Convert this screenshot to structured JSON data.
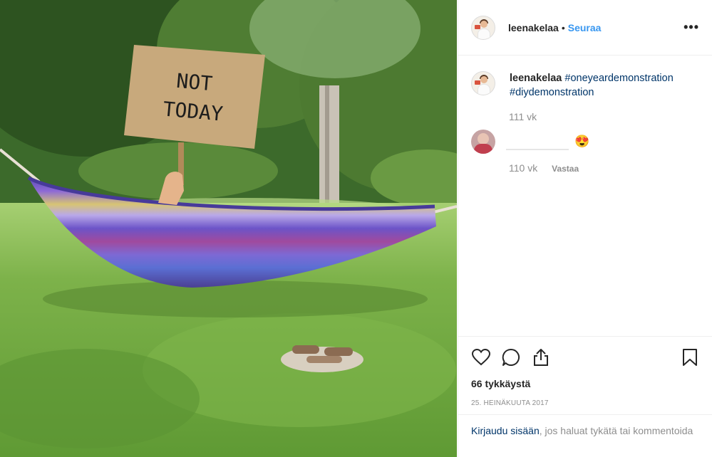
{
  "photo": {
    "sign_line1": "NOT",
    "sign_line2": "TODAY",
    "colors": {
      "grass": "#6fa842",
      "foliage": "#2f5a22",
      "sign": "#c8a97c"
    }
  },
  "header": {
    "username": "leenakelaa",
    "separator": "•",
    "follow_label": "Seuraa",
    "more_label": "•••"
  },
  "caption": {
    "username": "leenakelaa",
    "tag1": "#oneyeardemonstration",
    "tag2": "#diydemonstration",
    "time": "111 vk"
  },
  "comment": {
    "emoji": "😍",
    "time": "110 vk",
    "reply_label": "Vastaa"
  },
  "actions": {
    "icons": [
      "heart-icon",
      "comment-icon",
      "share-icon",
      "bookmark-icon"
    ],
    "likes": "66 tykkäystä",
    "date": "25. HEINÄKUUTA 2017"
  },
  "login": {
    "link": "Kirjaudu sisään",
    "rest": ", jos haluat tykätä tai kommentoida"
  },
  "colors": {
    "accent": "#3897f0",
    "link": "#003569",
    "muted": "#8e8e8e"
  }
}
